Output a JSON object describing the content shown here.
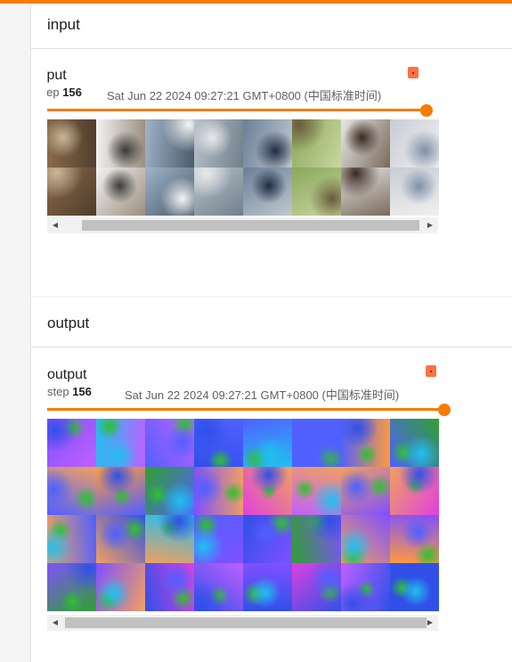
{
  "colors": {
    "accent": "#f57c00",
    "pin": "#ff7043"
  },
  "cards": [
    {
      "title": "input",
      "panel": {
        "run_name": "input",
        "step_label": "step",
        "step_value": "156",
        "wall_time": "Sat Jun 22 2024 09:27:21 GMT+0800 (中国标准时间)",
        "slider_value": 1.0,
        "pin_icon": "pin-icon",
        "grid": {
          "rows": 2,
          "cols": 8,
          "style": "photo",
          "description_tiles": [
            "dog",
            "dog",
            "ship",
            "airplane",
            "ship",
            "deer",
            "horse",
            "airplane",
            "cat",
            "dog",
            "cat",
            "cat",
            "horse",
            "dog",
            "automobile",
            "horse"
          ]
        }
      }
    },
    {
      "title": "output",
      "panel": {
        "run_name": "output",
        "step_label": "step",
        "step_value": "156",
        "wall_time": "Sat Jun 22 2024 09:27:21 GMT+0800 (中国标准时间)",
        "slider_value": 1.0,
        "pin_icon": "pin-icon",
        "grid": {
          "rows": 4,
          "cols": 8,
          "style": "false-color"
        }
      }
    }
  ],
  "scroll_arrows": {
    "left": "◀",
    "right": "▶"
  }
}
